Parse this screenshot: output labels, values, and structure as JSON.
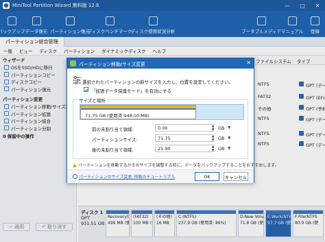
{
  "window": {
    "title": "MiniTool Partition Wizard 無料版 12.6",
    "controls": [
      "—",
      "□",
      "✕"
    ]
  },
  "toolbar": {
    "items": [
      {
        "label": "バックアップ",
        "icon": "backup-icon"
      },
      {
        "label": "データ復元",
        "icon": "data-recovery-icon"
      },
      {
        "label": "パーティション復元",
        "icon": "partition-recovery-icon"
      },
      {
        "label": "ディスクベンチマーク",
        "icon": "benchmark-icon"
      },
      {
        "label": "ディスク使用状況分析",
        "icon": "space-analyzer-icon"
      },
      {
        "label": "ブータブルメディア",
        "icon": "bootable-media-icon"
      },
      {
        "label": "マニュアル",
        "icon": "manual-icon"
      },
      {
        "label": "登録",
        "icon": "register-icon"
      }
    ]
  },
  "tabs": {
    "active": "パーティション総合管理"
  },
  "menubar": {
    "items": [
      "一般",
      "ビュー",
      "ディスク",
      "パーティション",
      "ダイナミックディスク",
      "ヘルプ"
    ]
  },
  "sidebar": {
    "wizard_header": "ウィザード",
    "wizard_items": [
      "OSをSSD/HDに移行",
      "パーティションコピー",
      "ディスクコピー",
      "パーティション復元"
    ],
    "change_header": "パーティション変更",
    "change_items": [
      "パーティション移動/サイズ変更",
      "パーティション拡張",
      "パーティション結合",
      "パーティション分割"
    ],
    "pending": "0 保留中の操作",
    "apply_label": "✓ 適用",
    "undo_label": "↶ 取り消す"
  },
  "table": {
    "headers": {
      "fs": "ファイルシステム",
      "type": "タイプ"
    },
    "rows": [
      {
        "fs": "NTFS",
        "type": "GPT (デー"
      },
      {
        "fs": "FAT32",
        "type": "GPT (EFIシ"
      },
      {
        "fs": "その他",
        "type": "GPT (予約"
      },
      {
        "fs": "NTFS",
        "type": "GPT (デー"
      },
      {
        "fs": "NTFS",
        "type": "GPT (デー"
      },
      {
        "fs": "NTFS",
        "type": "GPT (デー"
      }
    ]
  },
  "diskmap": {
    "disk_name": "ディスク 1",
    "disk_type": "GPT",
    "disk_size": "931.51 GB",
    "partitions": [
      {
        "name": "Recovery(N",
        "size": "499 MB (使"
      },
      {
        "name": "(FAT32)",
        "size": "100 MB (使"
      },
      {
        "name": "(その他)",
        "size": "16 MB"
      },
      {
        "name": "C:(NTFS)",
        "size": "237.9 GB (使用済: 86%)"
      },
      {
        "name": "D:New Volu",
        "size": "71.8 GB (使"
      },
      {
        "name": "E:Work(NTF",
        "size": "97.7 GB (使"
      },
      {
        "name": "F:File(NTFS",
        "size": "80.9 GB (使"
      }
    ]
  },
  "dialog": {
    "title": "パーティション移動/サイズ変更",
    "description": "選択されたパーティションの新サイズを入力し、位置を設定してください。",
    "checkbox_label": "「拡張データ保護モード」を有効にする",
    "group_label": "サイズと場所",
    "bar_text": "71.75 GB (使用済:948.00 MB)",
    "bar_used_fraction": 0.71,
    "fields": [
      {
        "label": "前の未割り当て領域:",
        "value": "0.00",
        "unit": "GB"
      },
      {
        "label": "パーティションサイズ:",
        "value": "71.75",
        "unit": "GB"
      },
      {
        "label": "後の未割り当て領域:",
        "value": "25.90",
        "unit": "GB"
      }
    ],
    "warning": "パーティションを移動するかそのサイズを調整する前に、データをバックアップすることをおすすめします。",
    "help_link": "パーティションのサイズ変更_移動のチュートリアル",
    "ok_label": "OK",
    "cancel_label": "キャンセル"
  }
}
